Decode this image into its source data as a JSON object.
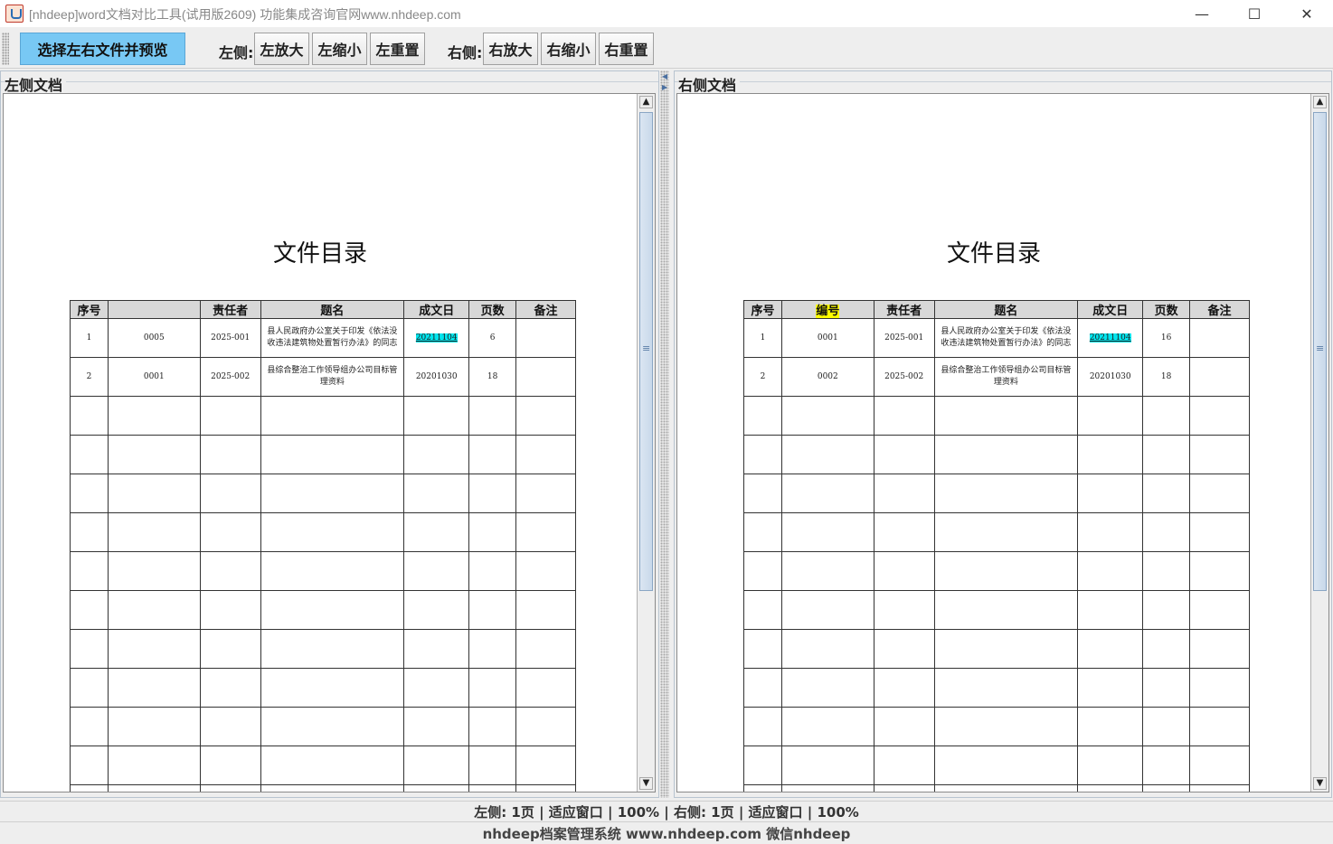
{
  "window": {
    "title": "[nhdeep]word文档对比工具(试用版2609) 功能集成咨询官网www.nhdeep.com",
    "minimize": "—",
    "maximize": "☐",
    "close": "✕"
  },
  "toolbar": {
    "select_label": "选择左右文件并预览",
    "left_label": "左侧:",
    "left_zoom_in": "左放大",
    "left_zoom_out": "左缩小",
    "left_reset": "左重置",
    "right_label": "右侧:",
    "right_zoom_in": "右放大",
    "right_zoom_out": "右缩小",
    "right_reset": "右重置"
  },
  "left_panel": {
    "title": "左侧文档",
    "doc_heading": "文件目录",
    "headers": [
      "序号",
      "",
      "责任者",
      "题名",
      "成文日",
      "页数",
      "备注"
    ],
    "rows": [
      [
        "1",
        "0005",
        "2025-001",
        "县人民政府办公室关于印发《依法没收违法建筑物处置暂行办法》的同志",
        "20211104",
        "6",
        ""
      ],
      [
        "2",
        "0001",
        "2025-002",
        "县综合整治工作领导组办公司目标管理资料",
        "20201030",
        "18",
        ""
      ]
    ]
  },
  "right_panel": {
    "title": "右侧文档",
    "doc_heading": "文件目录",
    "headers": [
      "序号",
      "编号",
      "责任者",
      "题名",
      "成文日",
      "页数",
      "备注"
    ],
    "rows": [
      [
        "1",
        "0001",
        "2025-001",
        "县人民政府办公室关于印发《依法没收违法建筑物处置暂行办法》的同志",
        "20211104",
        "16",
        ""
      ],
      [
        "2",
        "0002",
        "2025-002",
        "县综合整治工作领导组办公司目标管理资料",
        "20201030",
        "18",
        ""
      ]
    ]
  },
  "status": "左侧: 1页 | 适应窗口 | 100%  |  右侧: 1页 | 适应窗口 | 100%",
  "footer": "nhdeep档案管理系统 www.nhdeep.com 微信nhdeep",
  "colors": {
    "primary_button": "#78c8f4",
    "diff_yellow": "#ffff00",
    "diff_cyan": "#00e5ee"
  }
}
